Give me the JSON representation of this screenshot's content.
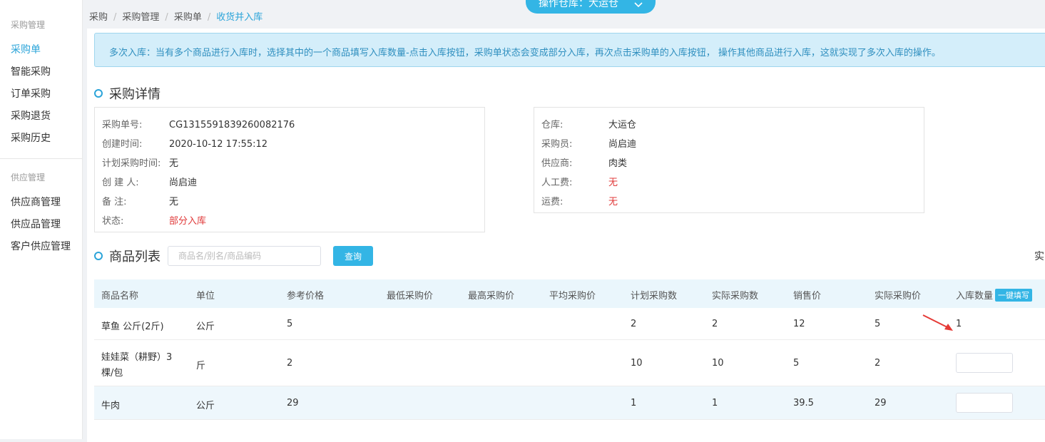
{
  "sidebar": {
    "group1": "采购管理",
    "group1_items": [
      "采购单",
      "智能采购",
      "订单采购",
      "采购退货",
      "采购历史"
    ],
    "group2": "供应管理",
    "group2_items": [
      "供应商管理",
      "供应品管理",
      "客户供应管理"
    ]
  },
  "breadcrumb": [
    "采购",
    "采购管理",
    "采购单",
    "收货并入库"
  ],
  "warehouse": {
    "label": "操作仓库：大运仓"
  },
  "notice": "多次入库：当有多个商品进行入库时，选择其中的一个商品填写入库数量-点击入库按钮，采购单状态会变成部分入库，再次点击采购单的入库按钮， 操作其他商品进行入库，这就实现了多次入库的操作。",
  "detail": {
    "title": "采购详情",
    "left": [
      {
        "k": "采购单号:",
        "v": "CG1315591839260082176"
      },
      {
        "k": "创建时间:",
        "v": "2020-10-12 17:55:12"
      },
      {
        "k": "计划采购时间:",
        "v": "无"
      },
      {
        "k": "创 建 人:",
        "v": "尚启迪"
      },
      {
        "k": "备 注:",
        "v": "无"
      },
      {
        "k": "状态:",
        "v": "部分入库"
      }
    ],
    "right": [
      {
        "k": "仓库:",
        "v": "大运仓"
      },
      {
        "k": "采购员:",
        "v": "尚启迪"
      },
      {
        "k": "供应商:",
        "v": "肉类"
      },
      {
        "k": "人工费:",
        "v": "无"
      },
      {
        "k": "运费:",
        "v": "无"
      }
    ]
  },
  "goods": {
    "title": "商品列表",
    "search_placeholder": "商品名/别名/商品编码",
    "search_button": "查询",
    "cut_text": "实",
    "fill_all": "一键填写",
    "columns": [
      "商品名称",
      "单位",
      "参考价格",
      "最低采购价",
      "最高采购价",
      "平均采购价",
      "计划采购数",
      "实际采购数",
      "销售价",
      "实际采购价",
      "入库数量"
    ],
    "rows": [
      {
        "name": "草鱼 公斤(2斤)",
        "unit": "公斤",
        "ref": "5",
        "min": "",
        "max": "",
        "avg": "",
        "plan": "2",
        "actual": "2",
        "sale": "12",
        "actual_price": "5",
        "qty": "1"
      },
      {
        "name1": "娃娃菜（耕野）3",
        "name2": "棵/包",
        "unit": "斤",
        "ref": "2",
        "min": "",
        "max": "",
        "avg": "",
        "plan": "10",
        "actual": "10",
        "sale": "5",
        "actual_price": "2",
        "qty": ""
      },
      {
        "name": "牛肉",
        "unit": "公斤",
        "ref": "29",
        "min": "",
        "max": "",
        "avg": "",
        "plan": "1",
        "actual": "1",
        "sale": "39.5",
        "actual_price": "29",
        "qty": ""
      }
    ]
  },
  "colors": {
    "accent": "#33b5e5",
    "red": "#e03a3a",
    "notice_bg": "#d4eefa"
  }
}
